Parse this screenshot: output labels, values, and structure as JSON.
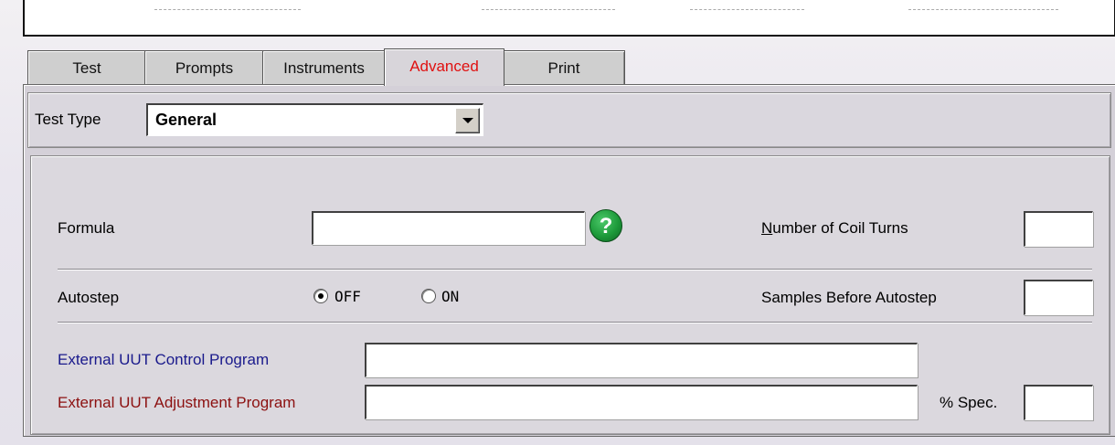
{
  "tabs": [
    {
      "label": "Test"
    },
    {
      "label": "Prompts"
    },
    {
      "label": "Instruments"
    },
    {
      "label": "Advanced"
    },
    {
      "label": "Print"
    }
  ],
  "active_tab": "Advanced",
  "test_type": {
    "label": "Test Type",
    "value": "General"
  },
  "formula": {
    "label": "Formula",
    "value": ""
  },
  "coil_turns": {
    "label_underlined": "N",
    "label_rest": "umber of Coil Turns",
    "value": ""
  },
  "autostep": {
    "label": "Autostep",
    "options": [
      {
        "label": "OFF",
        "checked": true
      },
      {
        "label": "ON",
        "checked": false
      }
    ]
  },
  "samples_before_autostep": {
    "label": "Samples Before Autostep",
    "value": ""
  },
  "external_control": {
    "label": "External UUT Control Program",
    "value": "",
    "color": "#1a1a8c"
  },
  "external_adjustment": {
    "label": "External UUT Adjustment Program",
    "value": "",
    "color": "#8c1010"
  },
  "spec": {
    "label": "% Spec.",
    "value": ""
  },
  "colors": {
    "active_tab_text": "#e01010",
    "help_icon": "#1d9a3a"
  },
  "help_icon": "question-mark-icon"
}
